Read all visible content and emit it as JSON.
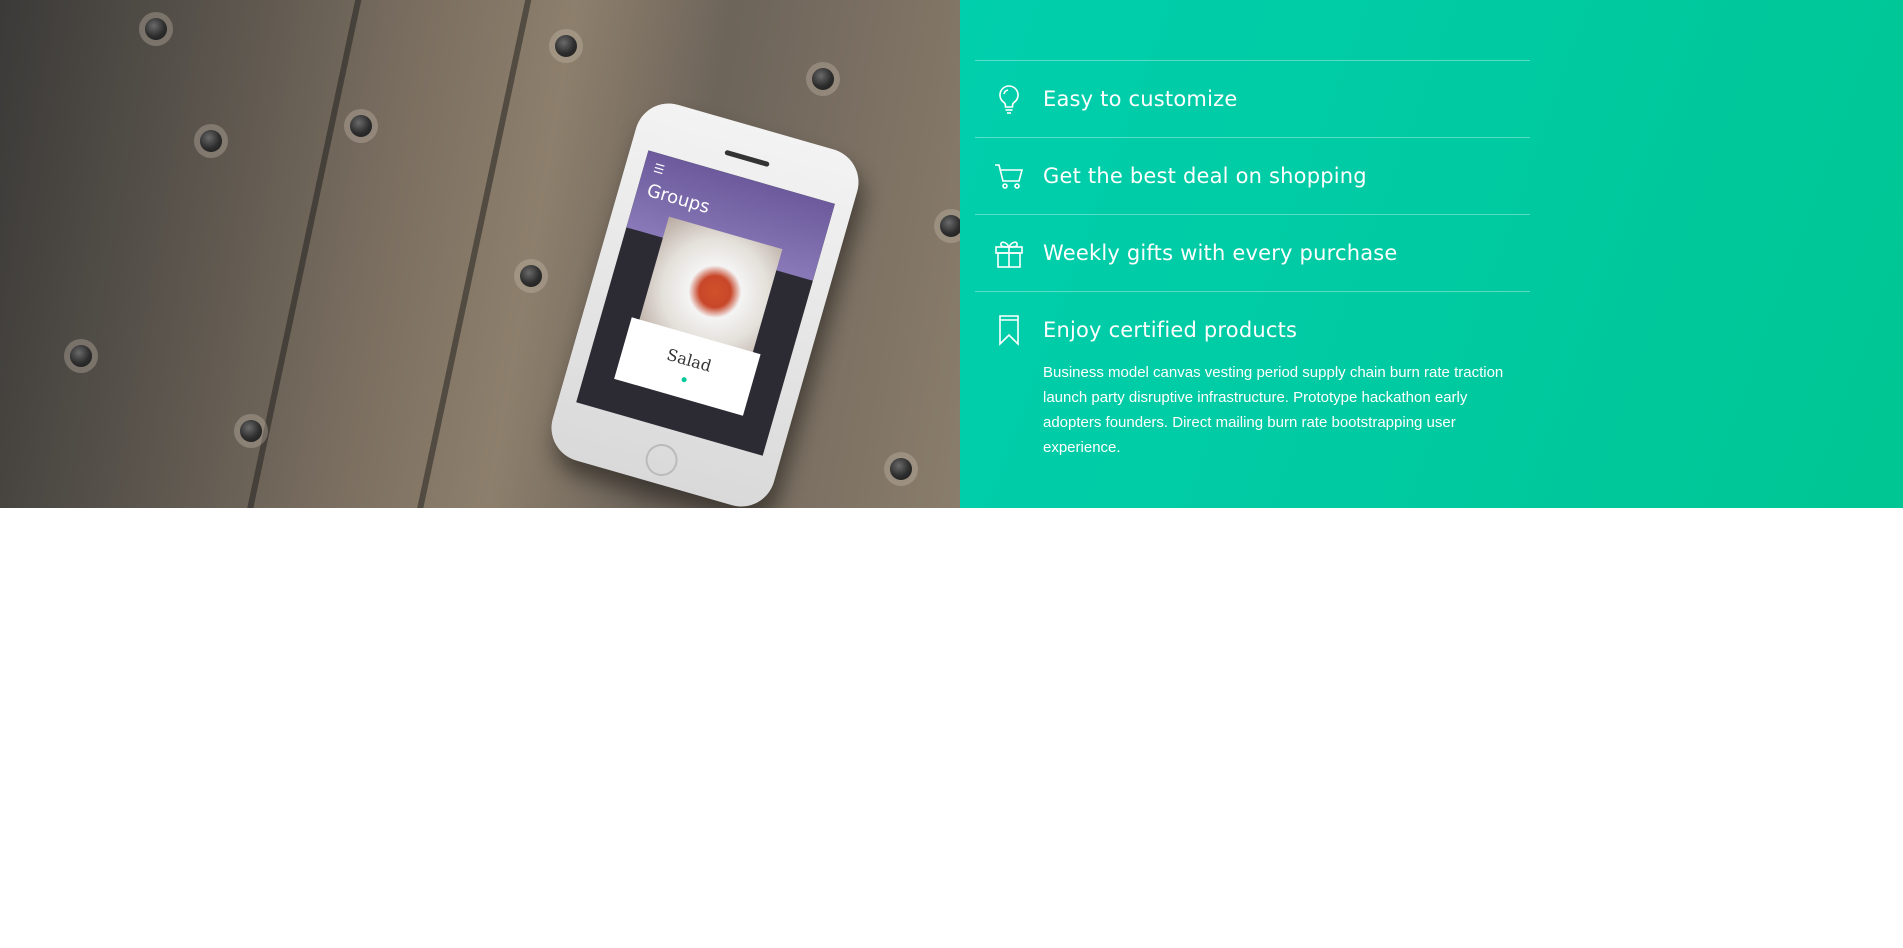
{
  "phone": {
    "screen_title": "Groups",
    "card_label": "Salad"
  },
  "features": [
    {
      "title": "Easy to customize",
      "icon": "lightbulb-icon"
    },
    {
      "title": "Get the best deal on shopping",
      "icon": "cart-icon"
    },
    {
      "title": "Weekly gifts with every purchase",
      "icon": "gift-icon"
    },
    {
      "title": "Enjoy certified products",
      "icon": "bookmark-icon",
      "description": "Business model canvas vesting period supply chain burn rate traction launch party disruptive infrastructure. Prototype hackathon early adopters founders. Direct mailing burn rate bootstrapping user experience."
    }
  ],
  "colors": {
    "accent": "#00C99F",
    "text_on_accent": "#FFFFFF",
    "phone_header": "#7766A8"
  }
}
